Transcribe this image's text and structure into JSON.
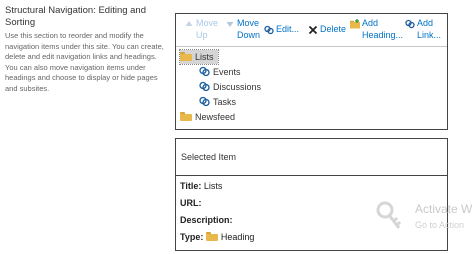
{
  "section": {
    "title_line1": "Structural Navigation: Editing and",
    "title_line2": "Sorting",
    "description": "Use this section to reorder and modify the navigation items under this site. You can create, delete and edit navigation links and headings. You can also move navigation items under headings and choose to display or hide pages and subsites."
  },
  "toolbar": {
    "move_up_1": "Move",
    "move_up_2": "Up",
    "move_down_1": "Move",
    "move_down_2": "Down",
    "edit": "Edit...",
    "delete": "Delete",
    "add_heading_1": "Add",
    "add_heading_2": "Heading...",
    "add_link_1": "Add",
    "add_link_2": "Link..."
  },
  "tree": {
    "lists": "Lists",
    "events": "Events",
    "discussions": "Discussions",
    "tasks": "Tasks",
    "newsfeed": "Newsfeed"
  },
  "selected_item": {
    "header": "Selected Item",
    "title_label": "Title:",
    "title_value": "Lists",
    "url_label": "URL:",
    "description_label": "Description:",
    "type_label": "Type:",
    "type_value": "Heading"
  },
  "watermark": {
    "line1": "Activate W",
    "line2": "Go to Action"
  },
  "colors": {
    "link_blue": "#0072c6",
    "disabled_blue": "#a9c9e8",
    "folder": "#e8b84a",
    "selection": "#d5d5d5"
  },
  "icons": [
    "arrow-up-icon",
    "arrow-down-icon",
    "edit-link-icon",
    "delete-x-icon",
    "add-heading-icon",
    "add-link-icon",
    "folder-icon",
    "link-icon",
    "key-icon"
  ]
}
